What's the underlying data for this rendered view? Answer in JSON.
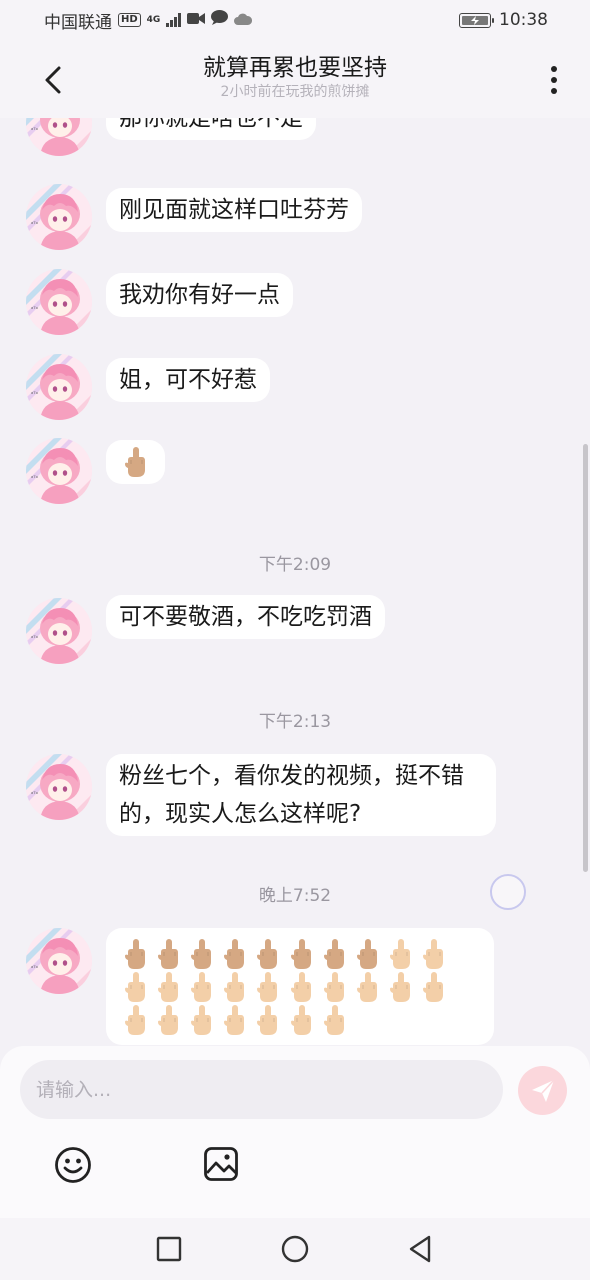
{
  "status_bar": {
    "carrier": "中国联通",
    "hd": "HD",
    "network": "4G",
    "time": "10:38"
  },
  "header": {
    "title": "就算再累也要坚持",
    "subtitle": "2小时前在玩我的煎饼摊"
  },
  "messages": [
    {
      "text": "那你就是啥也不是"
    },
    {
      "text": "刚见面就这样口吐芬芳"
    },
    {
      "text": "我劝你有好一点"
    },
    {
      "text": "姐，可不好惹"
    },
    {
      "emoji": "middle-finger"
    },
    {
      "time": "下午2:09"
    },
    {
      "text": "可不要敬酒，不吃吃罚酒"
    },
    {
      "time": "下午2:13"
    },
    {
      "text": "粉丝七个，看你发的视频，挺不错的，现实人怎么这样呢?"
    },
    {
      "time": "晚上7:52"
    },
    {
      "emoji_count": 27
    }
  ],
  "input": {
    "placeholder": "请输入..."
  },
  "icons": {
    "back": "back-arrow-icon",
    "more": "more-vertical-icon",
    "send": "send-icon",
    "emoji": "smiley-icon",
    "image": "image-icon"
  },
  "colors": {
    "background": "#f3f1f6",
    "bubble": "#ffffff",
    "send_button": "#fbd7dc",
    "timestamp": "#9a97a0"
  }
}
